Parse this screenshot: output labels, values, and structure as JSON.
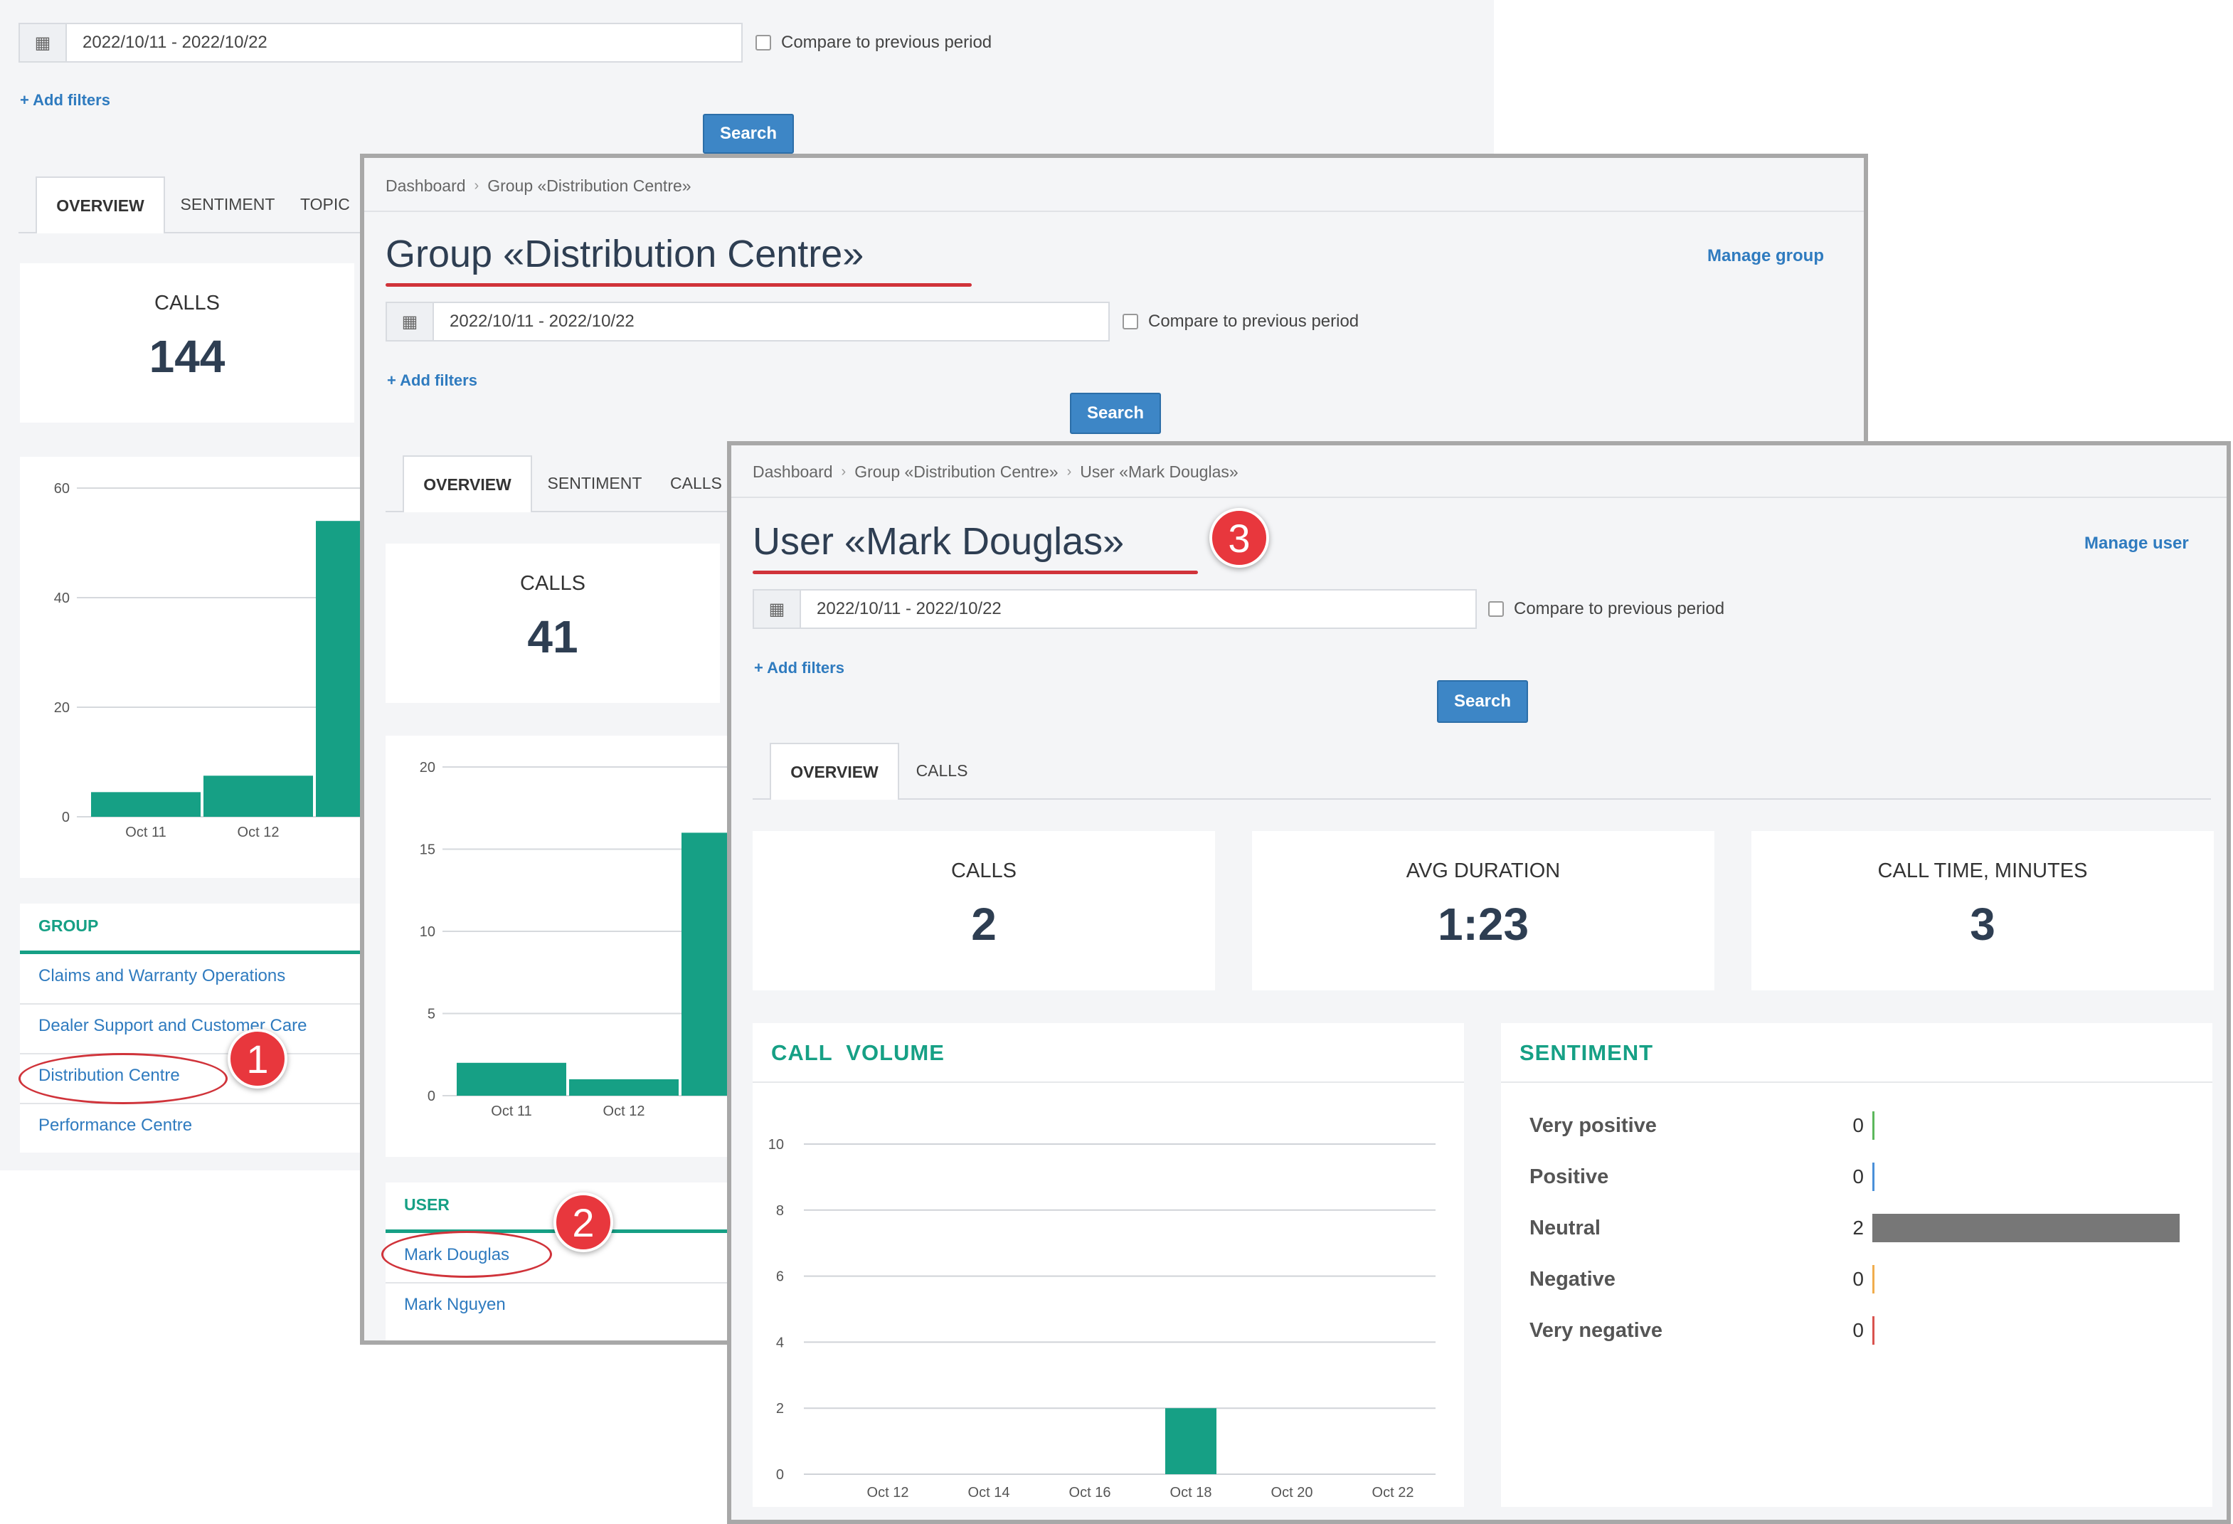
{
  "colors": {
    "accent": "#16a085",
    "link": "#2f7bbf",
    "button": "#3d86c6",
    "annotation": "#d0333a",
    "neutral_bar": "#777777"
  },
  "dashboard": {
    "date_range": "2022/10/11 - 2022/10/22",
    "compare_label": "Compare to previous period",
    "add_filters": "+ Add filters",
    "search_label": "Search",
    "tabs": [
      "OVERVIEW",
      "SENTIMENT",
      "TOPIC"
    ],
    "calls_label": "CALLS",
    "calls_value": "144",
    "chart_data": {
      "type": "bar",
      "categories": [
        "Oct 11",
        "Oct 12",
        ""
      ],
      "values": [
        4.5,
        7.5,
        54
      ],
      "ylim": [
        0,
        60
      ],
      "yticks": [
        "0",
        "20",
        "40",
        "60"
      ]
    },
    "group_header": "GROUP",
    "groups": [
      "Claims and Warranty Operations",
      "Dealer Support and Customer Care",
      "Distribution Centre",
      "Performance Centre"
    ]
  },
  "group_view": {
    "breadcrumb": [
      "Dashboard",
      "Group «Distribution Centre»"
    ],
    "title": "Group «Distribution Centre»",
    "manage": "Manage group",
    "date_range": "2022/10/11 - 2022/10/22",
    "compare_label": "Compare to previous period",
    "add_filters": "+ Add filters",
    "search_label": "Search",
    "tabs": [
      "OVERVIEW",
      "SENTIMENT",
      "CALLS"
    ],
    "calls_label": "CALLS",
    "calls_value": "41",
    "chart_data": {
      "type": "bar",
      "categories": [
        "Oct 11",
        "Oct 12",
        ""
      ],
      "values": [
        2,
        1,
        16
      ],
      "ylim": [
        0,
        20
      ],
      "yticks": [
        "0",
        "5",
        "10",
        "15",
        "20"
      ]
    },
    "user_header": "USER",
    "users": [
      "Mark Douglas",
      "Mark Nguyen"
    ]
  },
  "user_view": {
    "breadcrumb": [
      "Dashboard",
      "Group «Distribution Centre»",
      "User «Mark Douglas»"
    ],
    "title": "User «Mark Douglas»",
    "manage": "Manage user",
    "date_range": "2022/10/11 - 2022/10/22",
    "compare_label": "Compare to previous period",
    "add_filters": "+ Add filters",
    "search_label": "Search",
    "tabs": [
      "OVERVIEW",
      "CALLS"
    ],
    "stats": [
      {
        "label": "CALLS",
        "value": "2"
      },
      {
        "label": "AVG DURATION",
        "value": "1:23"
      },
      {
        "label": "CALL TIME, MINUTES",
        "value": "3"
      }
    ],
    "call_volume_title": "CALL  VOLUME",
    "chart_data": {
      "type": "bar",
      "categories": [
        "Oct 12",
        "Oct 14",
        "Oct 16",
        "Oct 18",
        "Oct 20",
        "Oct 22"
      ],
      "bars": [
        {
          "x": "Oct 18",
          "value": 2
        }
      ],
      "values": [
        0,
        0,
        0,
        2,
        0,
        0
      ],
      "ylim": [
        0,
        10
      ],
      "yticks": [
        "0",
        "2",
        "4",
        "6",
        "8",
        "10"
      ]
    },
    "sentiment_title": "SENTIMENT",
    "sentiment": [
      {
        "name": "Very positive",
        "count": "0",
        "value": 0,
        "color": "#5cb85c"
      },
      {
        "name": "Positive",
        "count": "0",
        "value": 0,
        "color": "#4a90d9"
      },
      {
        "name": "Neutral",
        "count": "2",
        "value": 2,
        "color": "#777777"
      },
      {
        "name": "Negative",
        "count": "0",
        "value": 0,
        "color": "#f0ad4e"
      },
      {
        "name": "Very negative",
        "count": "0",
        "value": 0,
        "color": "#d9534f"
      }
    ]
  },
  "annotations": [
    "1",
    "2",
    "3"
  ]
}
